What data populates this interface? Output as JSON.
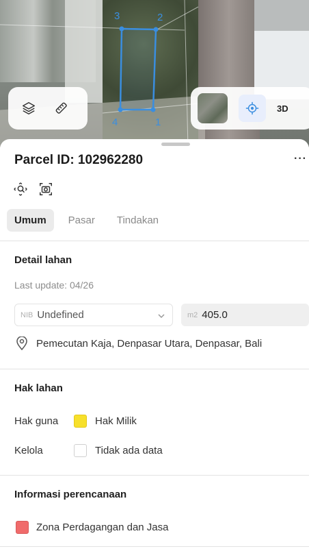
{
  "map": {
    "vertex_labels": [
      "3",
      "2",
      "4",
      "1"
    ],
    "outline_color": "#3a8ee0",
    "mode_3d_label": "3D",
    "icons": [
      "layers-icon",
      "ruler-icon",
      "satellite-thumbnail",
      "crosshair-icon"
    ]
  },
  "sheet": {
    "title": "Parcel ID: 102962280",
    "more_label": "···",
    "tabs": [
      {
        "label": "Umum",
        "active": true
      },
      {
        "label": "Pasar",
        "active": false
      },
      {
        "label": "Tindakan",
        "active": false
      }
    ]
  },
  "detail": {
    "title": "Detail lahan",
    "last_update": "Last update: 04/26",
    "nib_prefix": "NIB",
    "nib_value": "Undefined",
    "area_prefix": "m2",
    "area_value": "405.0",
    "address": "Pemecutan Kaja, Denpasar Utara, Denpasar, Bali"
  },
  "rights": {
    "title": "Hak lahan",
    "rows": [
      {
        "label": "Hak guna",
        "value": "Hak Milik",
        "color": "#f7e02b"
      },
      {
        "label": "Kelola",
        "value": "Tidak ada data",
        "color": "#ffffff"
      }
    ]
  },
  "planning": {
    "title": "Informasi perencanaan",
    "zone": "Zona Perdagangan dan Jasa",
    "zone_color": "#f06b6b"
  }
}
